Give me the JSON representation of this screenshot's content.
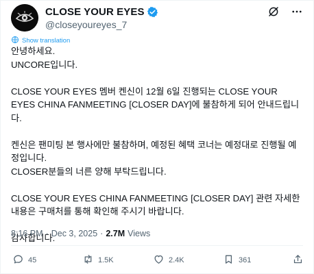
{
  "author": {
    "display_name": "CLOSE YOUR EYES",
    "handle": "@closeyoureyes_7",
    "verified": true
  },
  "translate_label": "Show translation",
  "post": {
    "lines": [
      "안녕하세요.",
      "UNCORE입니다.",
      "",
      "CLOSE YOUR EYES 멤버 켄신이 12월 6일 진행되는 CLOSE YOUR EYES CHINA FANMEETING [CLOSER DAY]에 불참하게 되어 안내드립니다.",
      "",
      "켄신은 팬미팅 본 행사에만 불참하며, 예정된 혜택 코너는 예정대로 진행될 예정입니다.",
      "CLOSER분들의 너른 양해 부탁드립니다.",
      "",
      "CLOSE YOUR EYES CHINA FANMEETING [CLOSER DAY] 관련 자세한 내용은 구매처를 통해 확인해 주시기 바랍니다.",
      "",
      "감사합니다."
    ]
  },
  "meta": {
    "time": "8:16 PM",
    "separator": "·",
    "date": "Dec 3, 2025",
    "views_count": "2.7M",
    "views_label": "Views"
  },
  "actions": {
    "replies": "45",
    "reposts": "1.5K",
    "likes": "2.4K",
    "bookmarks": "361"
  },
  "colors": {
    "accent": "#1d9bf0",
    "text": "#0f1419",
    "secondary": "#536471"
  },
  "icons": [
    "grok-icon",
    "more-icon",
    "translate-icon",
    "reply-icon",
    "repost-icon",
    "like-icon",
    "bookmark-icon",
    "share-icon",
    "verified-badge-icon"
  ]
}
